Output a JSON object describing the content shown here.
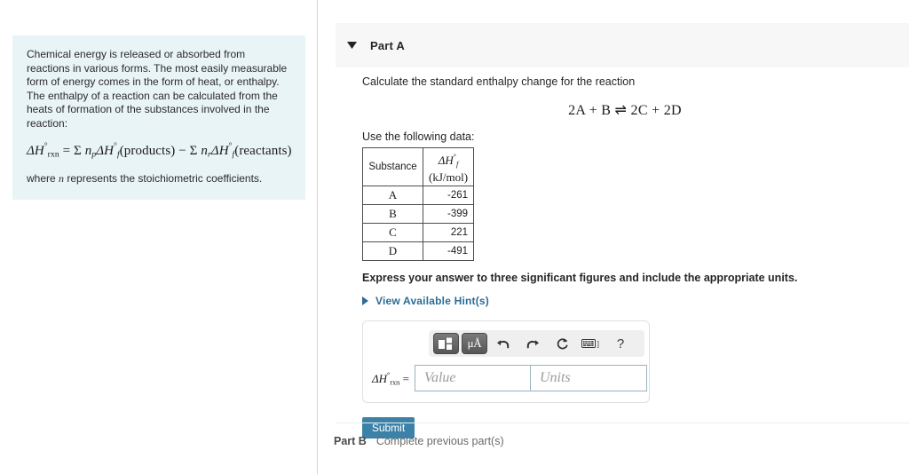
{
  "top_stub_buttons": [
    {
      "name": "toolbar-button-1"
    },
    {
      "name": "toolbar-button-2"
    },
    {
      "name": "toolbar-button-3"
    }
  ],
  "info_panel": {
    "paragraph": "Chemical energy is released or absorbed from reactions in various forms. The most easily measurable form of energy comes in the form of heat, or enthalpy. The enthalpy of a reaction can be calculated from the heats of formation of the substances involved in the reaction:",
    "equation_plain": "ΔH°rxn = Σ np ΔH°f (products) − Σ nr ΔH°f (reactants)",
    "equation_parts": {
      "lhs_symbol": "ΔH",
      "lhs_sup": "°",
      "lhs_sub": "rxn",
      "equals": "=",
      "sigma": "Σ",
      "n_products_sub": "p",
      "products_label": "(products)",
      "minus": "−",
      "n_reactants_sub": "r",
      "reactants_label": "(reactants)",
      "dh_symbol": "ΔH",
      "dh_sup": "°",
      "dh_sub": "f",
      "n_symbol": "n"
    },
    "footnote_pre": "where ",
    "footnote_var": "n",
    "footnote_post": " represents the stoichiometric coefficients."
  },
  "part_a": {
    "caret_icon": "caret-down-icon",
    "title": "Part A",
    "prompt": "Calculate the standard enthalpy change for the reaction",
    "reaction": "2A + B ⇌ 2C + 2D",
    "use_data_label": "Use the following data:",
    "table": {
      "headers": {
        "substance": "Substance",
        "enthalpy_symbol": "ΔH",
        "enthalpy_sup": "°",
        "enthalpy_sub": "f",
        "enthalpy_units": "(kJ/mol)"
      },
      "rows": [
        {
          "substance": "A",
          "value": "-261"
        },
        {
          "substance": "B",
          "value": "-399"
        },
        {
          "substance": "C",
          "value": "221"
        },
        {
          "substance": "D",
          "value": "-491"
        }
      ]
    },
    "express_note": "Express your answer to three significant figures and include the appropriate units.",
    "hints": {
      "caret_icon": "caret-right-icon",
      "label": "View Available Hint(s)"
    },
    "answer_widget": {
      "toolbar": [
        {
          "icon": "template-blocks-icon",
          "label": ""
        },
        {
          "icon": "units-micro-angstrom-icon",
          "label": "μÅ"
        },
        {
          "icon": "undo-icon",
          "label": ""
        },
        {
          "icon": "redo-icon",
          "label": ""
        },
        {
          "icon": "reset-icon",
          "label": ""
        },
        {
          "icon": "keyboard-icon",
          "label": ""
        },
        {
          "icon": "help-icon",
          "label": "?"
        }
      ],
      "label_symbol": "ΔH",
      "label_sup": "°",
      "label_sub": "rxn",
      "label_equals": "=",
      "value_placeholder": "Value",
      "units_placeholder": "Units",
      "value": "",
      "units": ""
    },
    "submit_label": "Submit"
  },
  "part_b": {
    "title": "Part B",
    "status": "Complete previous part(s)"
  },
  "colors": {
    "info_panel_bg": "#e9f4f6",
    "part_header_bg": "#f7f7f7",
    "link_blue": "#2b6c98",
    "submit_blue": "#3c82a8",
    "field_border": "#9ab3c0",
    "stub_button": "#a8c0d4"
  }
}
